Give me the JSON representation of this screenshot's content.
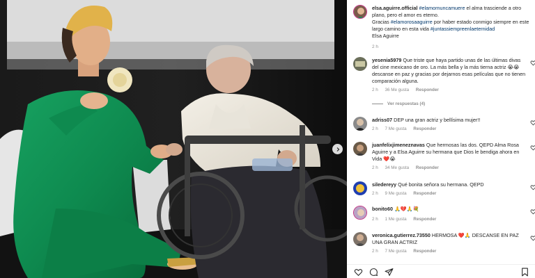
{
  "post": {
    "username": "elsa.aguirre.official",
    "caption_tag1": "#elamornuncamuere",
    "caption_line1": " el alma trasciende a otro plano, pero el amor es eterno.",
    "caption_line2": "Gracias ",
    "caption_tag2": "#elamorosaaguirre",
    "caption_line3": " por haber estado conmigo siempre en este largo camino en esta vida ",
    "caption_tag3": "#juntassiempreenlaeternidad",
    "caption_signature": "Elsa Aguirre",
    "time": "2 h"
  },
  "comments": [
    {
      "user": "yesenia5979",
      "text": "Que triste que haya partido unas de las últimas divas del cine mexicano de oro. La más bella y la más tierna actriz 😭😭 descanse en paz y gracias por dejarnos esas películas que no tienen comparación alguna.",
      "time": "2 h",
      "likes": "36 Me gusta",
      "reply": "Responder",
      "view_replies": "Ver respuestas (4)"
    },
    {
      "user": "adriss07",
      "text": "DEP una gran actriz y bellísima mujer!!",
      "time": "2 h",
      "likes": "7 Me gusta",
      "reply": "Responder"
    },
    {
      "user": "juanfelixjimeneznavas",
      "text": "Que hermosas las dos. QEPD Alma Rosa Aguirre y a Elsa Aguirre su hermana que Dios le bendiga ahora en Vida ❤️😭",
      "time": "2 h",
      "likes": "34 Me gusta",
      "reply": "Responder"
    },
    {
      "user": "siledereyy",
      "text": "Qué bonita señora su hermana. QEPD",
      "time": "2 h",
      "likes": "9 Me gusta",
      "reply": "Responder"
    },
    {
      "user": "bonito60",
      "text": "🙏💔🙏💐",
      "time": "2 h",
      "likes": "1 Me gusta",
      "reply": "Responder"
    },
    {
      "user": "veronica.gutierrez.73550",
      "text": "HERMOSA ❤️🙏 DESCANSE EN PAZ UNA GRAN ACTRIZ",
      "time": "2 h",
      "likes": "7 Me gusta",
      "reply": "Responder"
    }
  ],
  "icons": {
    "like": "heart-icon",
    "comment": "comment-icon",
    "share": "share-icon",
    "save": "bookmark-icon",
    "next": "chevron-right-icon"
  },
  "colors": {
    "link": "#00376b",
    "muted": "#8e8e8e",
    "dress": "#0f8a4f"
  }
}
